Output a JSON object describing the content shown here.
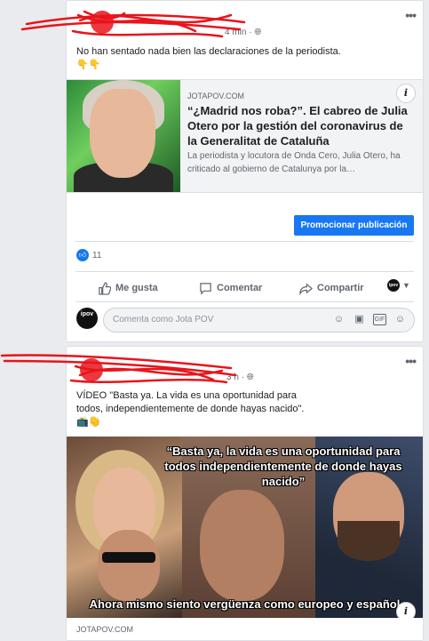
{
  "post1": {
    "meta_time": "4 min",
    "text": "No han sentado nada bien las declaraciones de la periodista.",
    "emoji": "👇👇",
    "link": {
      "source": "JOTAPOV.COM",
      "title": "“¿Madrid nos roba?”. El cabreo de Julia Otero por la gestión del coronavirus de la Generalitat de Cataluña",
      "description": "La periodista y locutora de Onda Cero, Julia Otero, ha criticado al gobierno de Catalunya por la…",
      "info": "i"
    },
    "promote_label": "Promocionar publicación",
    "like_count": "11",
    "actions": {
      "like": "Me gusta",
      "comment": "Comentar",
      "share": "Compartir"
    },
    "comment_placeholder": "Comenta como Jota POV",
    "avatar_text": "ipov"
  },
  "post2": {
    "meta_time": "3 h",
    "text": "VÍDEO \"Basta ya. La vida es una oportunidad para todos, independientemente de donde hayas nacido\". 👏👏",
    "emoji": "📺👇",
    "meme_top": "“Basta ya, la vida es una oportunidad para todos independientemente de donde hayas nacido”",
    "meme_bottom": "Ahora mismo siento vergüenza como europeo y español",
    "source": "JOTAPOV.COM",
    "info": "i"
  },
  "colors": {
    "primary": "#1877f2",
    "scribble": "#e8141b"
  }
}
